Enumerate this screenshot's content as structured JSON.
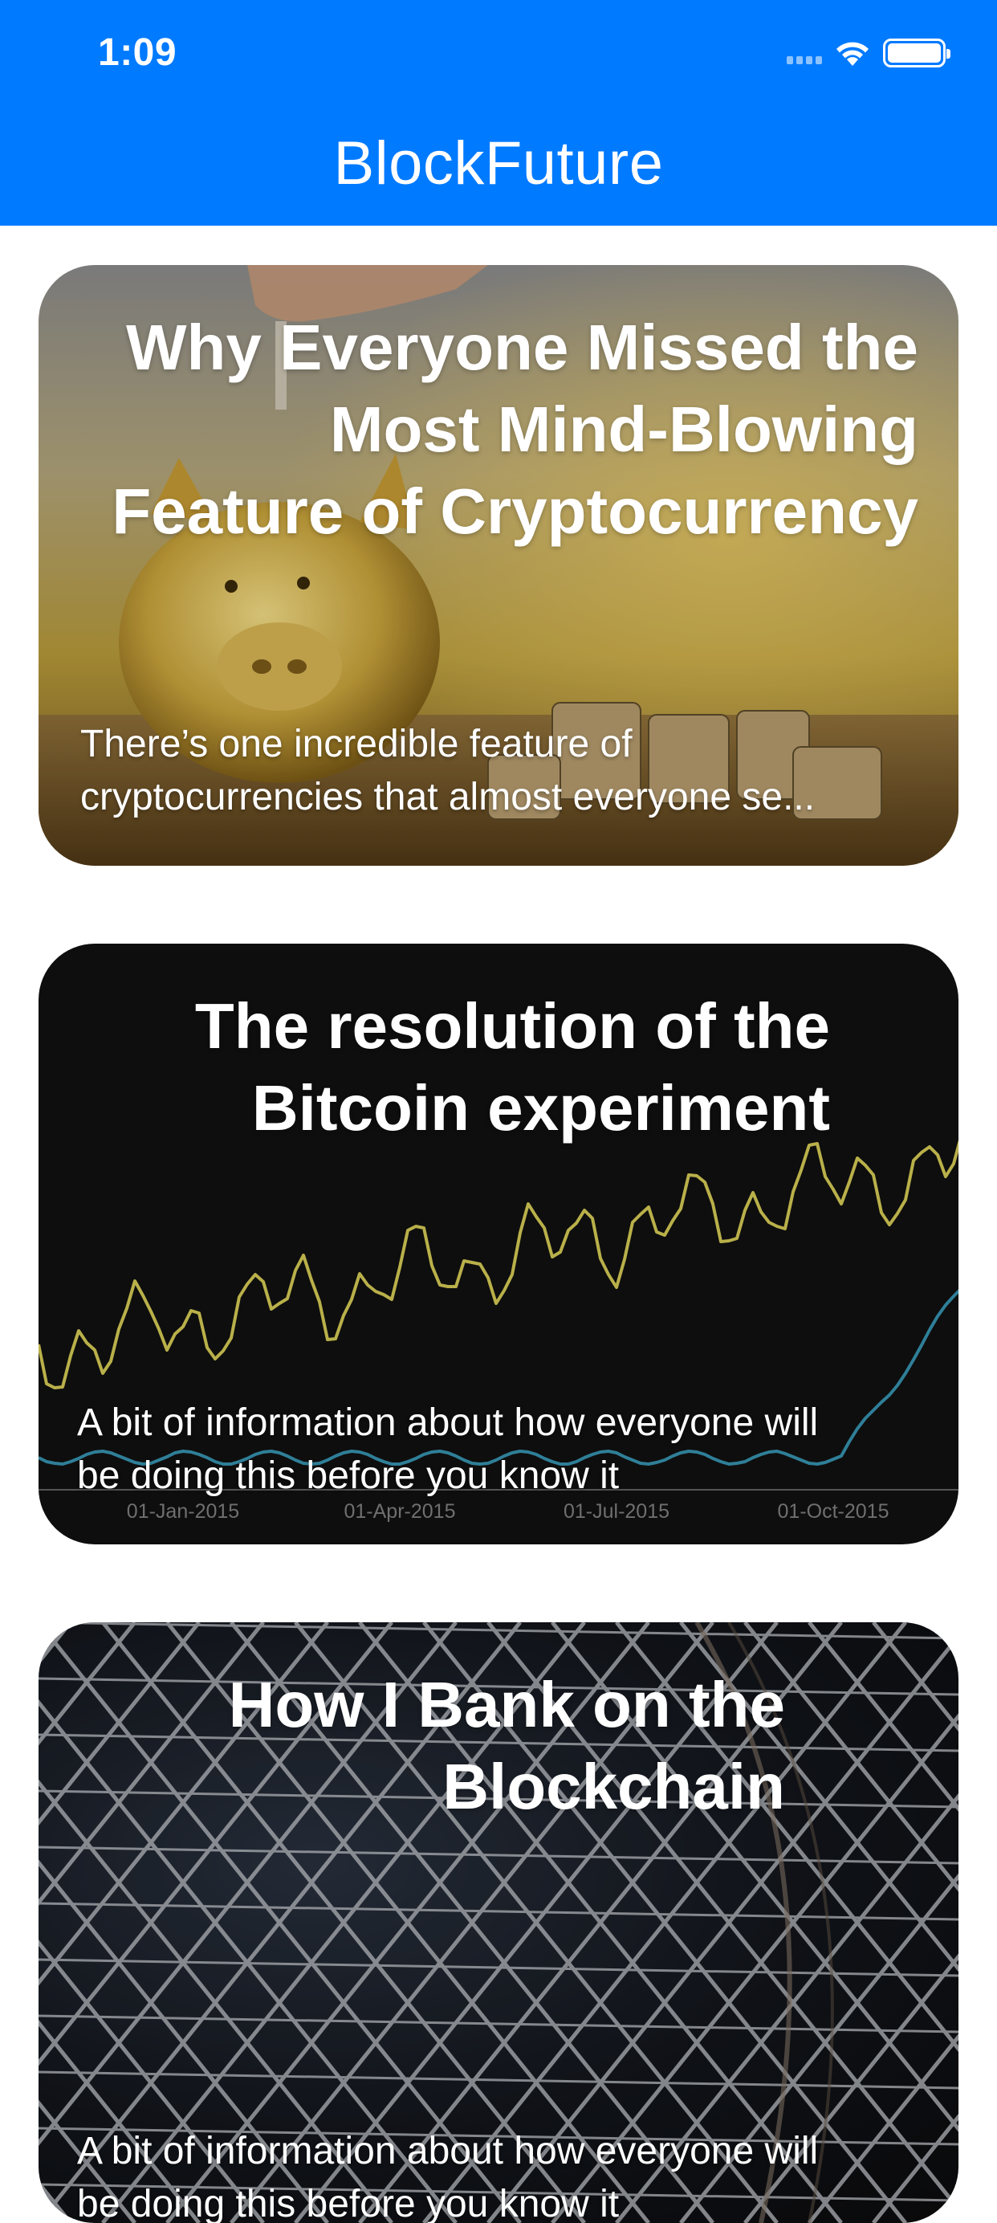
{
  "status_bar": {
    "time": "1:09"
  },
  "app": {
    "title": "BlockFuture",
    "accent_color": "#007AFF"
  },
  "articles": [
    {
      "title_lines": [
        "Why Everyone Missed the",
        "Most Mind-Blowing",
        "Feature of Cryptocurrency"
      ],
      "summary_lines": [
        "There’s one incredible feature of",
        "cryptocurrencies that almost everyone se..."
      ],
      "image": "piggy-bank-with-coins"
    },
    {
      "title_lines": [
        "The resolution of the",
        "Bitcoin experiment"
      ],
      "summary_lines": [
        "A bit of information about how everyone will",
        "be doing this before you know it"
      ],
      "image": "price-chart",
      "chart_labels": [
        "01-Jan-2015",
        "01-Apr-2015",
        "01-Jul-2015",
        "01-Oct-2015"
      ]
    },
    {
      "title_lines": [
        "How I Bank on the",
        "Blockchain"
      ],
      "summary_lines": [
        "A bit of information about how everyone will",
        "be doing this before you know it"
      ],
      "image": "steel-lattice-structure"
    }
  ]
}
